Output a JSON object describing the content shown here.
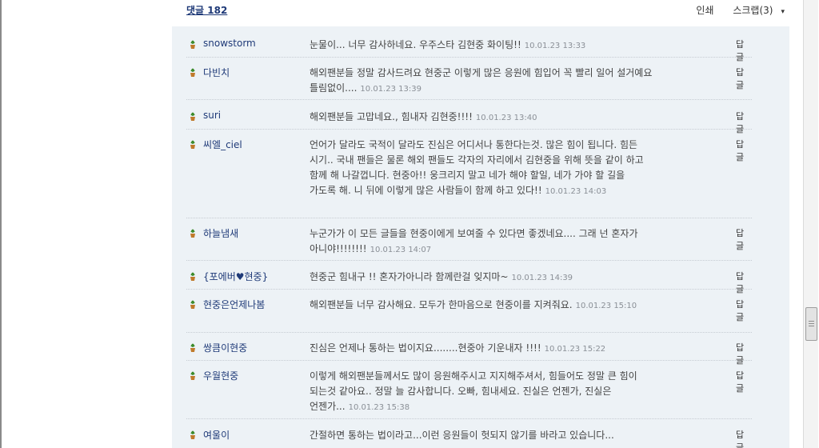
{
  "header": {
    "comment_count": "댓글 182",
    "print_label": "인쇄",
    "scrap_label": "스크랩(3)",
    "scrap_arrow": "▾"
  },
  "comments": [
    {
      "nick": "snowstorm",
      "text": "눈물이... 너무 감사하네요. 우주스타 김현중 화이팅!!",
      "time": "10.01.23 13:33",
      "reply": "답글"
    },
    {
      "nick": "다빈치",
      "text": "해외팬분들 정말 감사드려요 현중군 이렇게 많은 응원에 힘입어 꼭 빨리 일어 설거예요 틀림없이....",
      "time": "10.01.23 13:39",
      "reply": "답글"
    },
    {
      "nick": "suri",
      "text": "해외팬분들 고맙네요., 힘내자 김현중!!!!",
      "time": "10.01.23 13:40",
      "reply": "답글"
    },
    {
      "nick": "씨엘_ciel",
      "text": "언어가 달라도 국적이 달라도 진심은 어디서나 통한다는것. 많은 힘이 됩니다. 힘든 시기.. 국내 팬들은 물론 해외 팬들도 각자의 자리에서 김현중을 위해 뜻을 같이 하고 함께 해 나갈껍니다. 현중아!! 웅크리지 말고 네가 해야 할일, 네가 가야 할 길을 가도록 해. 니 뒤에 이렇게 많은 사람들이 함께 하고 있다!!",
      "time": "10.01.23 14:03",
      "reply": "답글"
    },
    {
      "nick": "하늘냄새",
      "text": "누군가가 이 모든 글들을 현중이에게 보여줄 수 있다면 좋겠네요.... 그래 넌 혼자가 아니야!!!!!!!!",
      "time": "10.01.23 14:07",
      "reply": "답글"
    },
    {
      "nick": "{포에버♥현중}",
      "text": "현중군 힘내구 !! 혼자가아니라 함께란걸 잊지마~",
      "time": "10.01.23 14:39",
      "reply": "답글"
    },
    {
      "nick": "현중은언제나봄",
      "text": "해외팬분들 너무 감사해요. 모두가 한마음으로 현중이를 지켜줘요.",
      "time": "10.01.23 15:10",
      "reply": "답글"
    },
    {
      "nick": "쌍큼이현중",
      "text": "진심은 언제나 통하는 법이지요........현중아 기운내자 !!!!",
      "time": "10.01.23 15:22",
      "reply": "답글"
    },
    {
      "nick": "우월현중",
      "text": "이렇게 해외팬분들께서도 많이 응원해주시고 지지해주셔서, 힘들어도 정말 큰 힘이 되는것 같아요.. 정말 늘 감사합니다. 오빠, 힘내세요. 진실은 언젠가, 진실은 언젠가...",
      "time": "10.01.23 15:38",
      "reply": "답글"
    },
    {
      "nick": "여울이",
      "text": "간절하면 통하는 법이라고...이런 응원들이 헛되지 않기를 바라고 있습니다...",
      "time": "",
      "reply": "답글"
    }
  ]
}
